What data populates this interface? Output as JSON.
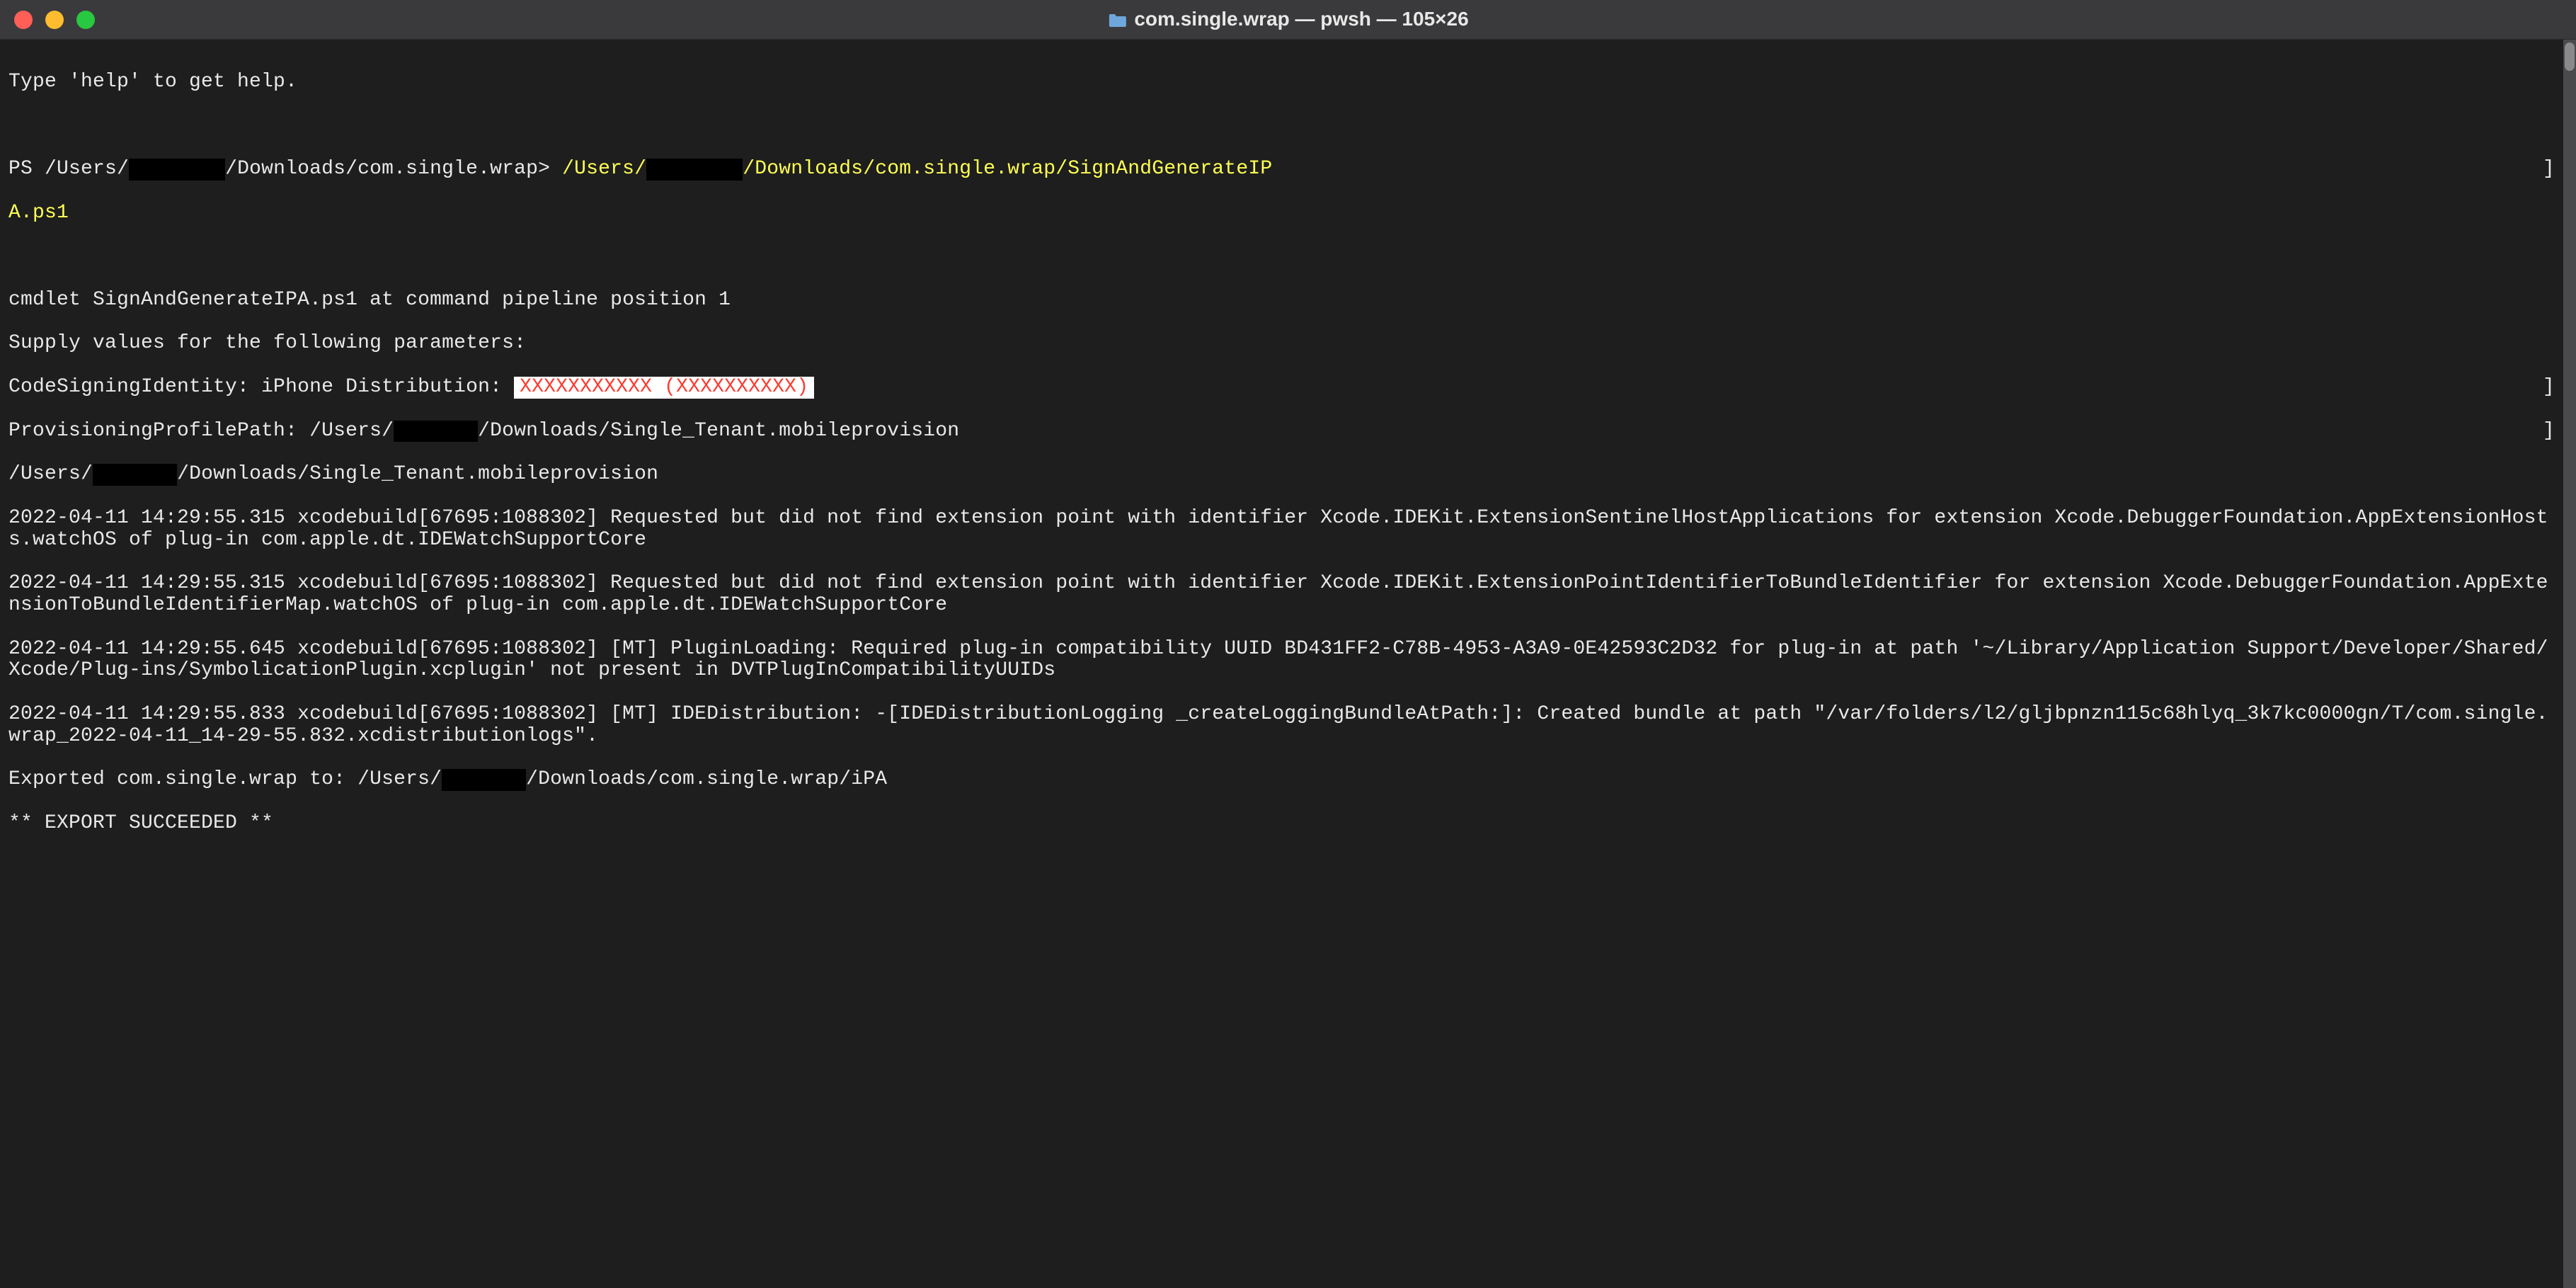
{
  "titlebar": {
    "title": "com.single.wrap — pwsh — 105×26"
  },
  "terminal": {
    "help_line": "Type 'help' to get help.",
    "prompt": {
      "prefix": "PS /Users/",
      "redacted1": "        ",
      "mid": "/Downloads/com.single.wrap> ",
      "cmd_prefix": "/Users/",
      "redacted2": "        ",
      "cmd_suffix": "/Downloads/com.single.wrap/SignAndGenerateIP",
      "cmd_wrap": "A.ps1"
    },
    "cmdlet_line": "cmdlet SignAndGenerateIPA.ps1 at command pipeline position 1",
    "supply_line": "Supply values for the following parameters:",
    "code_sign": {
      "label": "CodeSigningIdentity: iPhone Distribution: ",
      "masked": "XXXXXXXXXXX (XXXXXXXXXX)"
    },
    "prov_profile": {
      "prefix": "ProvisioningProfilePath: /Users/",
      "redacted": "       ",
      "suffix": "/Downloads/Single_Tenant.mobileprovision"
    },
    "echo_path": {
      "prefix": "/Users/",
      "redacted": "       ",
      "suffix": "/Downloads/Single_Tenant.mobileprovision"
    },
    "log1": "2022-04-11 14:29:55.315 xcodebuild[67695:1088302] Requested but did not find extension point with identifier Xcode.IDEKit.ExtensionSentinelHostApplications for extension Xcode.DebuggerFoundation.AppExtensionHosts.watchOS of plug-in com.apple.dt.IDEWatchSupportCore",
    "log2": "2022-04-11 14:29:55.315 xcodebuild[67695:1088302] Requested but did not find extension point with identifier Xcode.IDEKit.ExtensionPointIdentifierToBundleIdentifier for extension Xcode.DebuggerFoundation.AppExtensionToBundleIdentifierMap.watchOS of plug-in com.apple.dt.IDEWatchSupportCore",
    "log3": "2022-04-11 14:29:55.645 xcodebuild[67695:1088302] [MT] PluginLoading: Required plug-in compatibility UUID BD431FF2-C78B-4953-A3A9-0E42593C2D32 for plug-in at path '~/Library/Application Support/Developer/Shared/Xcode/Plug-ins/SymbolicationPlugin.xcplugin' not present in DVTPlugInCompatibilityUUIDs",
    "log4": "2022-04-11 14:29:55.833 xcodebuild[67695:1088302] [MT] IDEDistribution: -[IDEDistributionLogging _createLoggingBundleAtPath:]: Created bundle at path \"/var/folders/l2/gljbpnzn115c68hlyq_3k7kc0000gn/T/com.single.wrap_2022-04-11_14-29-55.832.xcdistributionlogs\".",
    "exported": {
      "prefix": "Exported com.single.wrap to: /Users/",
      "redacted": "       ",
      "suffix": "/Downloads/com.single.wrap/iPA"
    },
    "success": "** EXPORT SUCCEEDED **"
  }
}
